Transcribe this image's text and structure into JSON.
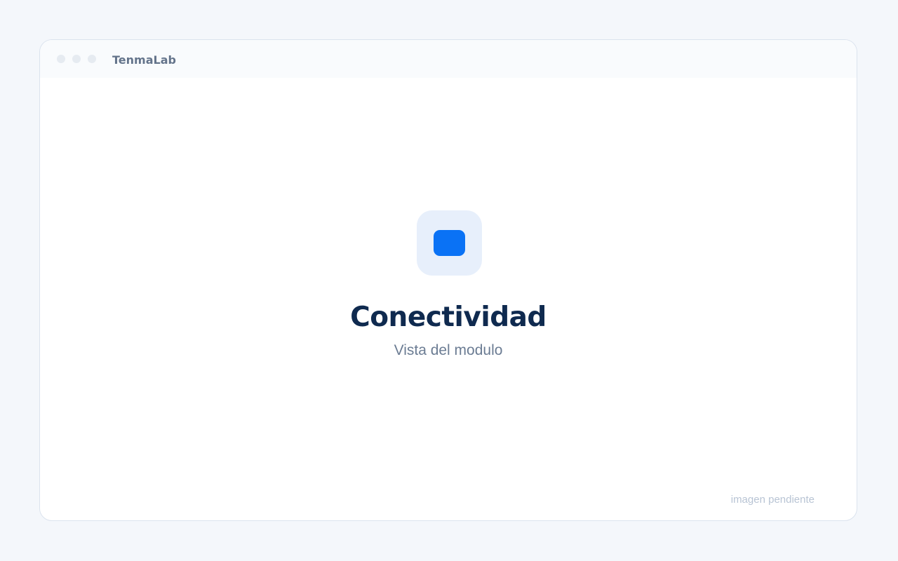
{
  "window": {
    "app_title": "TenmaLab"
  },
  "main": {
    "icon": "module-icon",
    "title": "Conectividad",
    "subtitle": "Vista del modulo",
    "placeholder_note": "imagen pendiente"
  },
  "colors": {
    "background": "#f4f7fb",
    "window": "#ffffff",
    "titlebar": "#f9fbfd",
    "accent": "#0a72f5",
    "icon_tile": "#e7effb",
    "title_text": "#0f2a4f",
    "subtitle_text": "#6b7c93",
    "note_text": "#b8c4d4"
  }
}
